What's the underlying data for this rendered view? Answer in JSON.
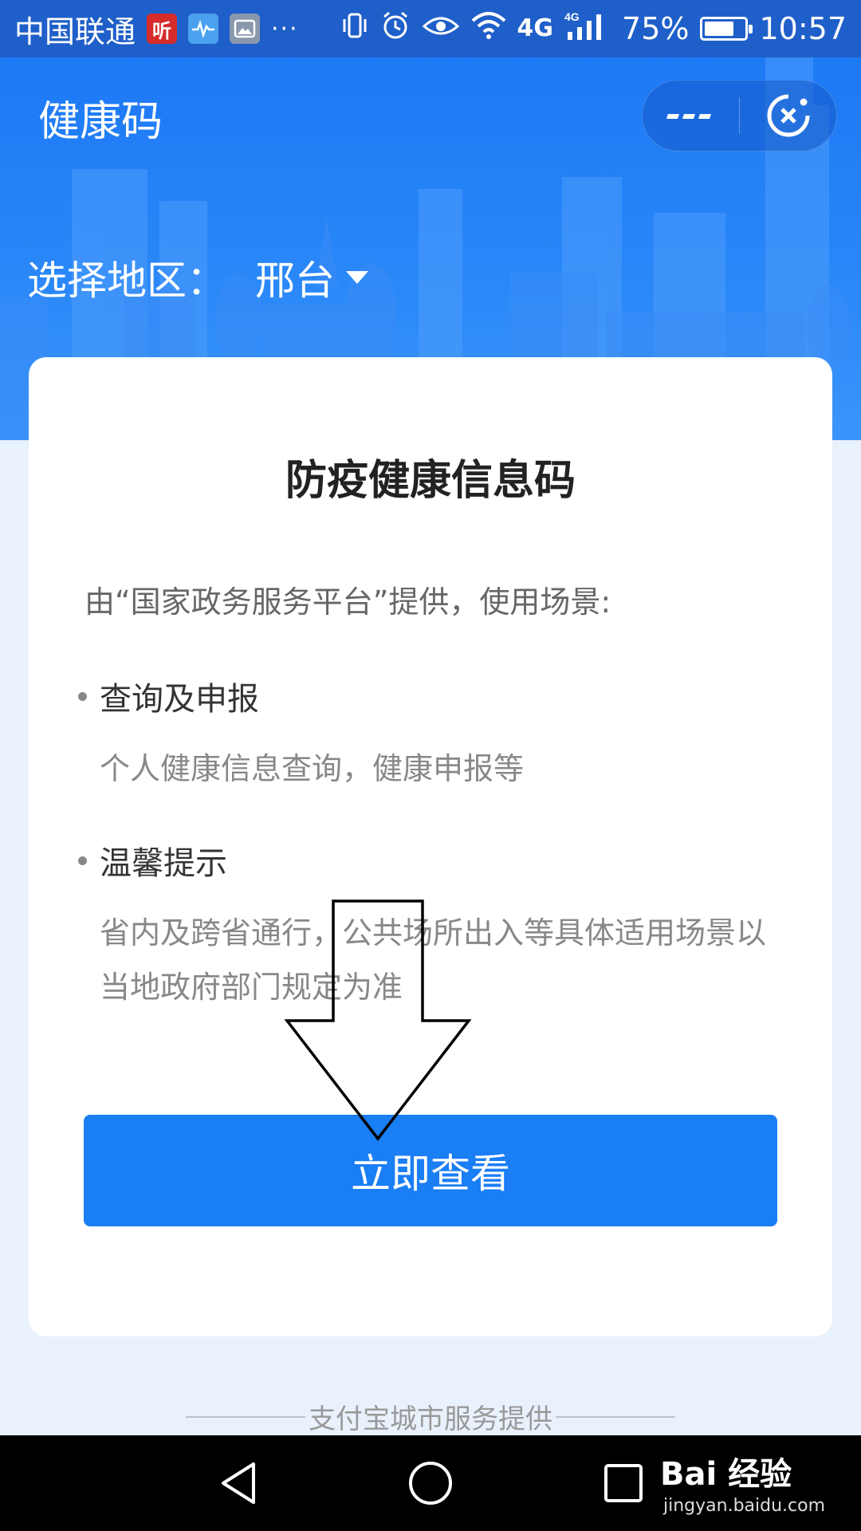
{
  "status_bar": {
    "carrier": "中国联通",
    "listen_icon_text": "听",
    "more": "···",
    "network_primary": "4G",
    "network_secondary": "4G",
    "battery_percent": "75%",
    "battery_level": 0.75,
    "time": "10:57"
  },
  "header": {
    "title": "健康码",
    "menu_icon": "more-dots-icon",
    "close_icon": "close-circle-icon",
    "region_label": "选择地区：",
    "region_value": "邢台"
  },
  "card": {
    "title": "防疫健康信息码",
    "intro": "由“国家政务服务平台”提供，使用场景:",
    "features": [
      {
        "title": "查询及申报",
        "desc": "个人健康信息查询，健康申报等"
      },
      {
        "title": "温馨提示",
        "desc": "省内及跨省通行，公共场所出入等具体适用场景以当地政府部门规定为准"
      }
    ],
    "button_label": "立即查看"
  },
  "footer": {
    "provider": "支付宝城市服务提供"
  },
  "watermark": {
    "brand": "Bai 经验",
    "url": "jingyan.baidu.com"
  },
  "colors": {
    "primary": "#1a7ef5",
    "header_blue": "#1d79f5",
    "status_bar": "#1f5fc9",
    "page_bg": "#e9f1fc"
  }
}
